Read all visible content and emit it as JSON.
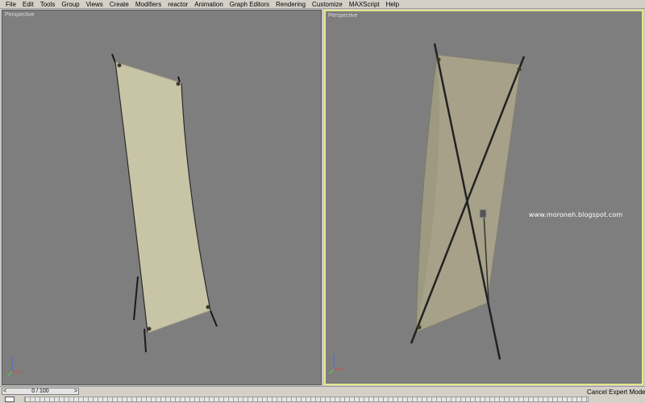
{
  "menubar": {
    "items": [
      "File",
      "Edit",
      "Tools",
      "Group",
      "Views",
      "Create",
      "Modifiers",
      "reactor",
      "Animation",
      "Graph Editors",
      "Rendering",
      "Customize",
      "MAXScript",
      "Help"
    ]
  },
  "viewports": {
    "left": {
      "label": "Perspective"
    },
    "right": {
      "label": "Perspective",
      "active": true,
      "watermark": "www.moroneh.blogspot.com"
    }
  },
  "timeline": {
    "frame_display": "0 / 100",
    "prev_arrow": "<",
    "next_arrow": ">"
  },
  "status": {
    "cancel_expert_mode": "Cancel Expert Mode"
  },
  "colors": {
    "viewport_bg": "#7e7e7e",
    "active_border": "#e6e68a",
    "banner_fill": "#c8c4a6",
    "stand_stroke": "#1a1a1a"
  },
  "icons": {
    "axis_gizmo": "axis-tripod-icon",
    "track_key": "key-filter-icon"
  }
}
